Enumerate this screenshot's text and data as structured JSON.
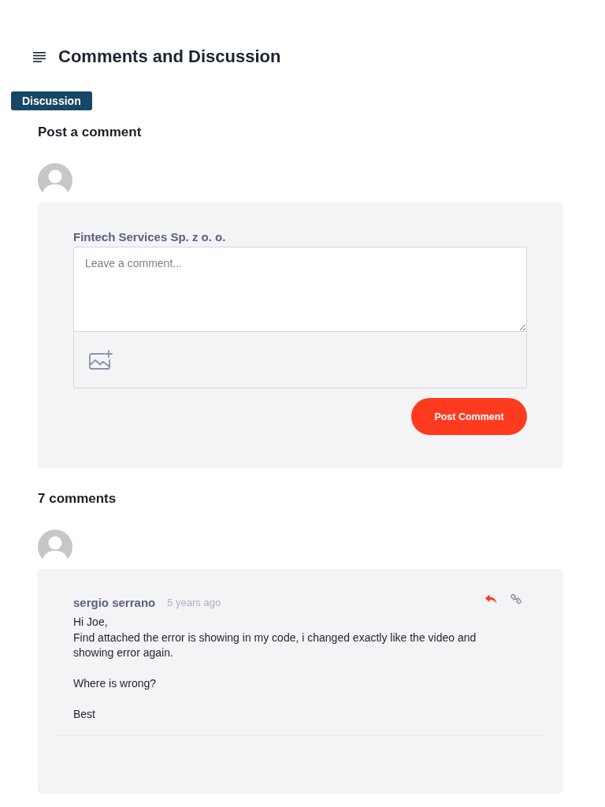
{
  "header": {
    "title": "Comments and Discussion"
  },
  "tabs": [
    {
      "label": "Discussion",
      "selected": true
    }
  ],
  "composer": {
    "heading": "Post a comment",
    "author": "Fintech Services Sp. z o. o.",
    "placeholder": "Leave a comment...",
    "submit": "Post Comment"
  },
  "comments_heading": "7 comments",
  "comments": [
    {
      "author": "sergio serrano",
      "time": "5 years ago",
      "body": "Hi Joe,\nFind attached the error is showing in my code, i changed exactly like the video and showing error again.\n\nWhere is wrong?\n\nBest"
    }
  ]
}
